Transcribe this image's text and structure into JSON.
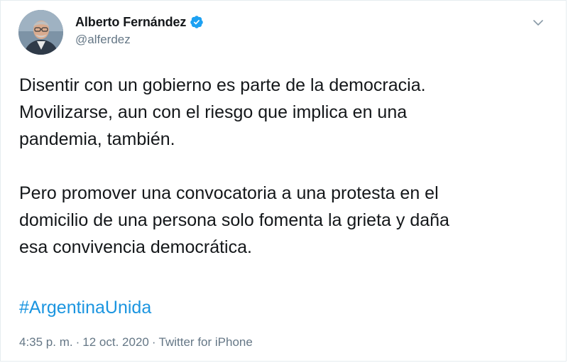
{
  "author": {
    "name": "Alberto Fernández",
    "handle": "@alferdez",
    "verified": true
  },
  "tweet": {
    "paragraphs": [
      "Disentir con un gobierno es parte de la democracia.\nMovilizarse, aun con el riesgo que implica en una\npandemia, también.",
      "Pero promover una convocatoria a una protesta en el\ndomicilio de una persona solo fomenta la grieta y daña\nesa convivencia democrática."
    ],
    "hashtag": "#ArgentinaUnida",
    "time": "4:35 p. m.",
    "separator1": "·",
    "date": "12 oct. 2020",
    "separator2": "·",
    "source": "Twitter for iPhone"
  },
  "icons": {
    "verified": "verified-badge-icon",
    "menu": "chevron-down-icon"
  },
  "colors": {
    "link": "#1b95e0",
    "verified": "#1da1f2",
    "muted": "#657786",
    "text": "#14171a"
  }
}
